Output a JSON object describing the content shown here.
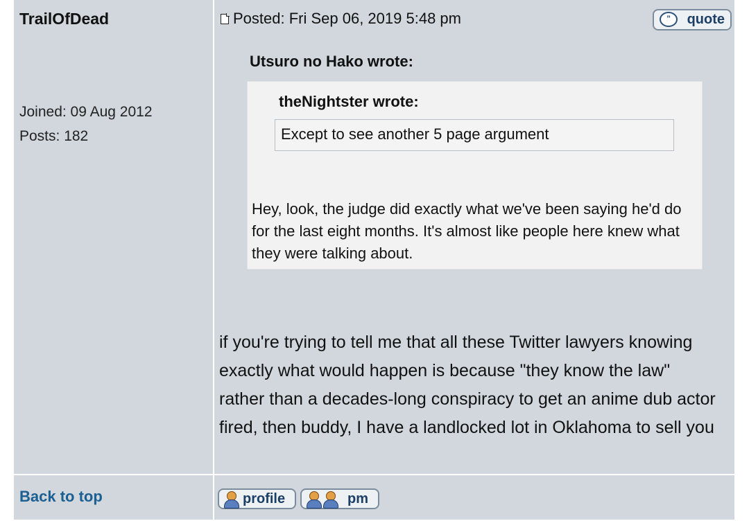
{
  "author": {
    "username": "TrailOfDead",
    "joined": "Joined: 09 Aug 2012",
    "posts": "Posts: 182"
  },
  "post": {
    "posted": "Posted: Fri Sep 06, 2019 5:48 pm",
    "quote_button": "quote",
    "outer_quote": {
      "label": "Utsuro no Hako wrote:",
      "text": "Hey, look, the judge did exactly what we've been saying he'd do for the last eight months. It's almost like people here knew what they were talking about."
    },
    "inner_quote": {
      "label": "theNightster wrote:",
      "text": "Except to see another 5 page argument"
    },
    "body": "if you're trying to tell me that all these Twitter lawyers knowing exactly what would happen is because \"they know the law\" rather than a decades-long conspiracy to get an anime dub actor fired, then buddy, I have a landlocked lot in Oklahoma to sell you"
  },
  "footer": {
    "back_to_top": "Back to top",
    "profile_button": "profile",
    "pm_button": "pm"
  },
  "icons": [
    "document-icon",
    "quote-icon",
    "profile-icon",
    "pm-icon"
  ],
  "colors": {
    "cell_bg": "#d1d7dc",
    "quote_bg": "#f2f2f2",
    "link": "#1c5f93",
    "button_text": "#1b3f66"
  }
}
